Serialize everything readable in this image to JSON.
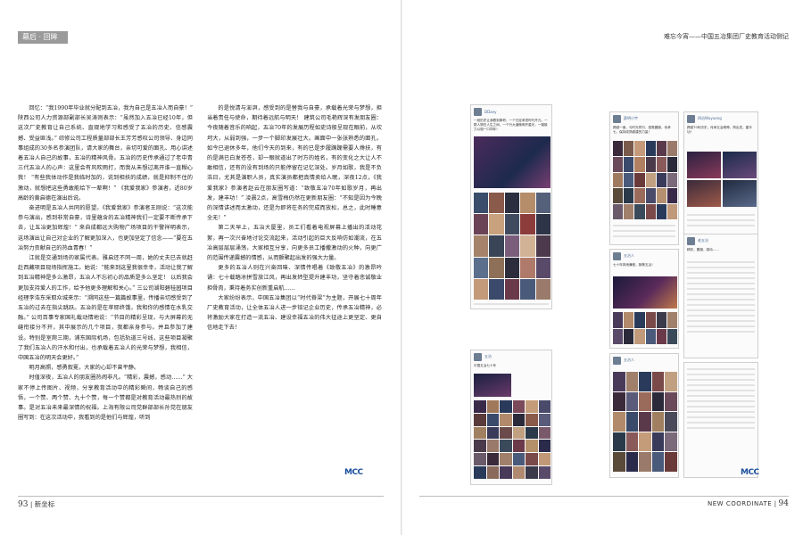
{
  "header": {
    "section_tab": "幕后 · 回眸",
    "running_title": "难忘今宵——中国五冶集团厂史教育活动侧记"
  },
  "article": {
    "col1": [
      "回忆：“我1990年毕业就分配到五冶，我为自己是五冶人而自豪！” 陕西公司人力资源部副部长吴涛则表示：“虽然加入五冶已经10年，但这次厂史教育让自己系统、直观地学习和感受了五冶的历史、信感震撼、受益匪浅。” 综修公司工程质量部部长王芳芳感叹公司领导、身边同事组成的30多名参演团队，请大家的舞台，亲切可爱的面孔、用心讲述着五冶人自己的故事，五冶的精神风骨。五冶的历史传承通过了老中青三代五冶人的心声：这里会有风吹雨打，而我从未想过离开谁一直糊心我！ “有些我体动作是我临时加的，说到相扶的成绩，就是抑制不住的激动，就想把这些勇敢能给下一辈啊！” 《我爱我家》参演者，近80岁高龄的黄启德在演出后说。",
      "奋进明是五冶人共同的愿望。《我爱我家》参演者王刚说：“这次能参与演出，感到非常自豪，诗里蕴含的五冶精神我们一定要不断传承下去，让五冶更加辉煌！” 来自成都远大购物广场项目的干警祥明表示，这场演出让自己对企业的了解更加深入，也更加坚定了信念——“要在五冶努力贡献自己的热血青春！”",
      "江就是交通到场的家属代表。雅启还不同一周，她的丈夫已去就赶赴西藏项目现场指挥施工。她说：“能来到这里我很幸幸，活动让我了解到五冶精神是多么激昂，五冶人不忘初心的品质是多么坚定！ 以后我会更加支持爱人的工作，给予他更多理解和关心。” 三公司湖阳碧桂园项目经理李浩东采取众城来示：“溯同这些一篇篇故事里，传播亲切感受到了五冶的过去在指尖跳跃。五冶的是在苹耶终饿，我和你的感情在水乳交融。” 公司百事专家国礼载动情地说：“节目的精彩呈现，与大屏幕的无缝衔接分不开，其中展示的几个项目，我都亲身参与。并且参加了建设。特别是室爬三期，浦东国际机场，包括轨道三号线，这些项目凝聚了我们五冶人的汗水和付出，也承载着五冶人的光荣与梦想，我相信，中国五冶的明天会更好。”",
      "明月高照，感勇叙冕，大家的心却不曾平静。",
      "时值深夜，五冶人的朋友圈热闹非凡。“精彩，震撼，感动……” 大家不停上传图片、视频，分享教育活动中的精彩瞬间，畅谈自己的感悟，一个赞、两个赞、九十个赞，每一个赞都是对教育活动最热烈的故事。是对五冶未来最深情的祝福。上海有限公司党群部部长孙党在朋友圈写到：在这次活动中，我看到的是他们与辉煌，听到"
    ],
    "col2": [
      "的是悦清与澎湃，感受到的是替我与自豪，承载着光荣与梦想，担当着责任与使命，期待着远航与明天！ 建筑公司毛艳辉深有发朋友圈：今夜随着音乐的响起，五冶70年的发展历程如史诗般呈现在眼前，从坎坷大，从弱到强，一步一个脚印发展壮大。画面中一张张熟悉的面孔，如今已退休多年，他们今天的到来，有的已是步履蹒跚需要人搀扶，有的是满已白发苍苍，却一眼就道出了时方的姓名，有的变化之大让人不敢相信，还有的没有到场的只能停留在记忆深处。岁月如歌，我是不负浩日，尤其是演职人员，真实演员都把真情卖给人眠，深夜12点，《我爱我家》参演者赵云在朋友圈写道：“致敬五冶70年如歌岁月，再出发，建丰功！” 凌晨2点，高雪梅仍然在更新朋友圈：“不知是因为今晚的深情讲述而太激动，还是为即将在务的完成而放松，总之，此时睡意全无！”",
      "第二天早上，五冶大厦里，员工们看着电视屏幕上播出的活动花絮，再一次兴奋地讨论交流起来，活动引起的巨大反响仿如潮流，在五冶高层层层涌荡，大家相互分享，向更多员工播撒激动的火种，向更广的范围传递震撼的情感，从而颤聚起出发的强大力量。",
      "更多的五冶人则在兴奋回味、深情传唱着《致敬五冶》的激昂吟诵：七十载踏冰拼雪旅江风，再出发转型提升建丰功，坚守着悲诚敬业担骨肉，秉持着务实创新重启航……",
      "大家纷纷表示，中国五冶集团以“时代脊梁”为主题，开展七十周年厂史教育活动，让全体五冶人进一步铭记企业历史，传承五冶精神，必将激励大家在打造一流五冶、建设幸福五冶的伟大征途上更坚定、更自信地走下去！"
    ]
  },
  "collage": {
    "posts": [
      {
        "user": "DDaey",
        "text": "一段历史让我看到厚积，一个日定承担时代开元，一群人物在人生之间，一个行大道微明开星光，一路致力以相一口同年！"
      },
      {
        "user": "薛明小宇",
        "text": "跨越一面，与时光同行，感受震撼、传承七，保持成熟稳建的力量！"
      },
      {
        "user": "四冶Wuyuong",
        "text": "跨越70年历史，传承五冶精神，再出发，建丰功！"
      },
      {
        "user": "五冶人",
        "text": "七十年风雨兼程，致敬五冶！"
      },
      {
        "user": "老五冶",
        "text": "精彩，震撼，感动……"
      },
      {
        "user": "五冶",
        "text": "中国五冶七十年"
      }
    ]
  },
  "footer": {
    "left_page_num": "93",
    "left_mag": "新坐标",
    "right_mag": "NEW COORDINATE",
    "right_page_num": "94",
    "logo_text": "MCC"
  }
}
